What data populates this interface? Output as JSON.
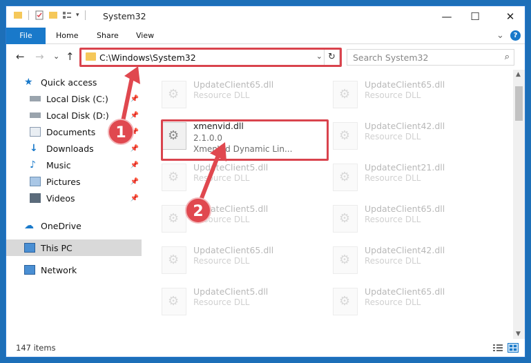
{
  "window": {
    "title": "System32",
    "controls": {
      "minimize": "—",
      "maximize": "☐",
      "close": "✕"
    }
  },
  "ribbon": {
    "tabs": [
      "File",
      "Home",
      "Share",
      "View"
    ],
    "collapse_icon": "⌄",
    "help_icon": "?"
  },
  "nav": {
    "back": "←",
    "forward": "→",
    "recent": "⌄",
    "up": "↑",
    "address_path": "C:\\Windows\\System32",
    "address_dropdown": "⌄",
    "refresh": "↻",
    "search_placeholder": "Search System32",
    "search_icon": "⌕"
  },
  "sidebar": {
    "items": [
      {
        "label": "Quick access",
        "icon": "star-icon",
        "pinned": false
      },
      {
        "label": "Local Disk (C:)",
        "icon": "drive-icon",
        "pinned": true
      },
      {
        "label": "Local Disk (D:)",
        "icon": "drive-icon",
        "pinned": true
      },
      {
        "label": "Documents",
        "icon": "documents-icon",
        "pinned": true
      },
      {
        "label": "Downloads",
        "icon": "download-icon",
        "pinned": true
      },
      {
        "label": "Music",
        "icon": "music-icon",
        "pinned": true
      },
      {
        "label": "Pictures",
        "icon": "pictures-icon",
        "pinned": true
      },
      {
        "label": "Videos",
        "icon": "videos-icon",
        "pinned": true
      },
      {
        "label": "OneDrive",
        "icon": "cloud-icon",
        "pinned": false
      },
      {
        "label": "This PC",
        "icon": "computer-icon",
        "pinned": false,
        "selected": true
      },
      {
        "label": "Network",
        "icon": "network-icon",
        "pinned": false
      }
    ],
    "pin_glyph": "📌"
  },
  "files": {
    "highlighted": {
      "name": "xmenvid.dll",
      "version": "2.1.0.0",
      "description": "XmenVid Dynamic Lin..."
    },
    "left_column": [
      {
        "name": "UpdateClient65.dll",
        "type": "Resource DLL"
      },
      {
        "name": "UpdateClient5.dll",
        "type": "Resource DLL"
      },
      {
        "name": "UpdateClient5.dll",
        "type": "Resource DLL"
      },
      {
        "name": "UpdateClient65.dll",
        "type": "Resource DLL"
      },
      {
        "name": "UpdateClient5.dll",
        "type": "Resource DLL"
      }
    ],
    "right_column": [
      {
        "name": "UpdateClient65.dll",
        "type": "Resource DLL"
      },
      {
        "name": "UpdateClient42.dll",
        "type": "Resource DLL"
      },
      {
        "name": "UpdateClient21.dll",
        "type": "Resource DLL"
      },
      {
        "name": "UpdateClient65.dll",
        "type": "Resource DLL"
      },
      {
        "name": "UpdateClient42.dll",
        "type": "Resource DLL"
      },
      {
        "name": "UpdateClient65.dll",
        "type": "Resource DLL"
      }
    ]
  },
  "status": {
    "item_count": "147 items"
  },
  "callouts": {
    "first": "1",
    "second": "2"
  },
  "colors": {
    "accent": "#1979ca",
    "highlight_red": "#d9434d",
    "callout": "#e0484f",
    "selected_nav": "#d9d9d9"
  }
}
